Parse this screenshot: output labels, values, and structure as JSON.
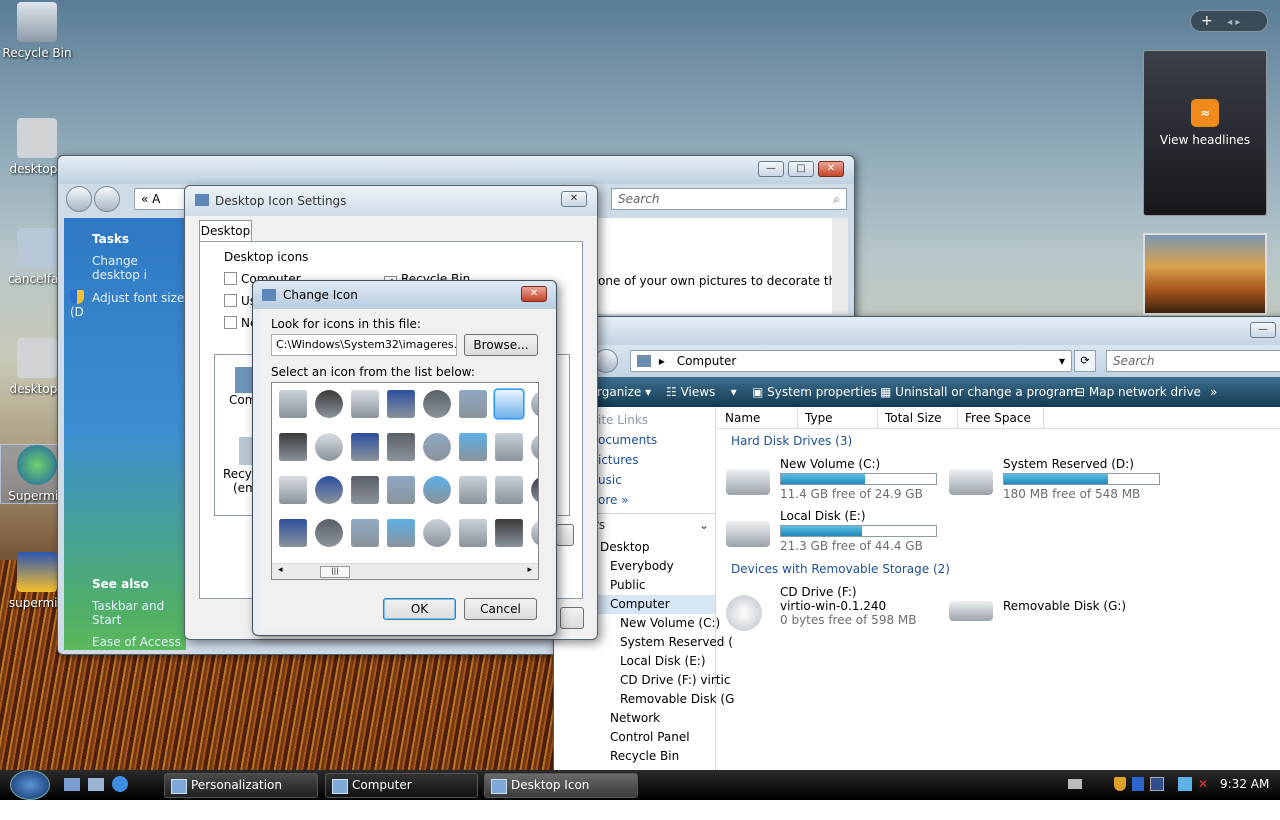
{
  "desktop": {
    "icons": [
      {
        "label": "Recycle Bin"
      },
      {
        "label": "desktop.i"
      },
      {
        "label": "cancelfag"
      },
      {
        "label": "desktop.i"
      },
      {
        "label": "Supermiu"
      },
      {
        "label": "supermiu"
      }
    ]
  },
  "gadgets": {
    "add_symbol": "+",
    "nav_symbol": "◂ ▸",
    "feed_label": "View headlines",
    "feed_icon": "rss-icon"
  },
  "personalization": {
    "address_prefix": "«",
    "address_text": "A",
    "search_placeholder": "Search",
    "tasks": {
      "header": "Tasks",
      "links": [
        "Change desktop i",
        "Adjust font size (D"
      ],
      "see_also_header": "See also",
      "see_also_links": [
        "Taskbar and Start",
        "Ease of Access"
      ]
    },
    "content_text": "one of your own pictures to decorate the"
  },
  "icon_settings": {
    "title": "Desktop Icon Settings",
    "tab": "Desktop",
    "group_label": "Desktop icons",
    "checks": [
      {
        "label": "Computer",
        "checked": false
      },
      {
        "label": "Recycle Bin",
        "checked": true
      },
      {
        "label": "Use",
        "checked": false
      },
      {
        "label": "Ne",
        "checked": false
      }
    ],
    "preview_labels": [
      "Comp",
      "Recyc",
      "(em"
    ]
  },
  "change_icon": {
    "title": "Change Icon",
    "look_label": "Look for icons in this file:",
    "file_path": "C:\\Windows\\System32\\imageres.dll",
    "browse": "Browse...",
    "list_label": "Select an icon from the list below:",
    "ok": "OK",
    "cancel": "Cancel",
    "scroll_left": "◂",
    "scroll_right": "▸",
    "thumb_grip": "|||"
  },
  "computer": {
    "address": "Computer",
    "search_placeholder": "Search",
    "toolbar": [
      "rganize",
      "Views",
      "System properties",
      "Uninstall or change a program",
      "Map network drive",
      "»"
    ],
    "columns": [
      "Name",
      "Type",
      "Total Size",
      "Free Space"
    ],
    "fav_links": [
      "ite Links",
      "ocuments",
      "ictures",
      "usic",
      "ore  »"
    ],
    "folders_label": "rs",
    "tree": [
      "Desktop",
      "Everybody",
      "Public",
      "Computer",
      "New Volume (C:)",
      "System Reserved (",
      "Local Disk (E:)",
      "CD Drive (F:) virtic",
      "Removable Disk (G",
      "Network",
      "Control Panel",
      "Recycle Bin"
    ],
    "group_hdd": "Hard Disk Drives (3)",
    "group_removable": "Devices with Removable Storage (2)",
    "drives": [
      {
        "name": "New Volume (C:)",
        "free": "11.4 GB free of 24.9 GB",
        "used_fraction": 0.54
      },
      {
        "name": "System Reserved (D:)",
        "free": "180 MB free of 548 MB",
        "used_fraction": 0.67
      },
      {
        "name": "Local Disk (E:)",
        "free": "21.3 GB free of 44.4 GB",
        "used_fraction": 0.52
      },
      {
        "name": "CD Drive (F:)",
        "sub": "virtio-win-0.1.240",
        "free": "0 bytes free of 598 MB"
      },
      {
        "name": "Removable Disk (G:)"
      }
    ]
  },
  "taskbar": {
    "items": [
      "Personalization",
      "Computer",
      "Desktop Icon Settings"
    ],
    "time": "9:32 AM"
  }
}
